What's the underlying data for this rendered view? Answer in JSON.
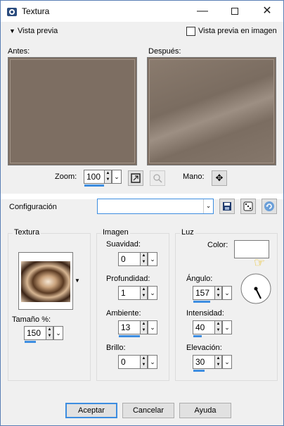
{
  "window": {
    "title": "Textura"
  },
  "preview": {
    "toggle_label": "Vista previa",
    "image_preview_label": "Vista previa en imagen",
    "before_label": "Antes:",
    "after_label": "Después:"
  },
  "zoom": {
    "label": "Zoom:",
    "value": "100",
    "pan_label": "Mano:"
  },
  "config": {
    "label": "Configuración",
    "value": ""
  },
  "textura": {
    "title": "Textura",
    "size_label": "Tamaño %:",
    "size_value": "150"
  },
  "imagen": {
    "title": "Imagen",
    "suavidad_label": "Suavidad:",
    "suavidad_value": "0",
    "profundidad_label": "Profundidad:",
    "profundidad_value": "1",
    "ambiente_label": "Ambiente:",
    "ambiente_value": "13",
    "brillo_label": "Brillo:",
    "brillo_value": "0"
  },
  "luz": {
    "title": "Luz",
    "color_label": "Color:",
    "angulo_label": "Ángulo:",
    "angulo_value": "157",
    "intensidad_label": "Intensidad:",
    "intensidad_value": "40",
    "elevacion_label": "Elevación:",
    "elevacion_value": "30"
  },
  "buttons": {
    "accept": "Aceptar",
    "cancel": "Cancelar",
    "help": "Ayuda"
  },
  "colors": {
    "accent": "#3d8de0",
    "preview": "#7d6e62",
    "light_color": "#ffffff"
  },
  "icons": [
    "app-icon",
    "minimize-icon",
    "maximize-icon",
    "close-icon",
    "caret-down-icon",
    "zoom-fit-icon",
    "zoom-disabled-icon",
    "pan-icon",
    "save-icon",
    "dice-icon",
    "reset-icon",
    "hand-pointer-icon"
  ]
}
